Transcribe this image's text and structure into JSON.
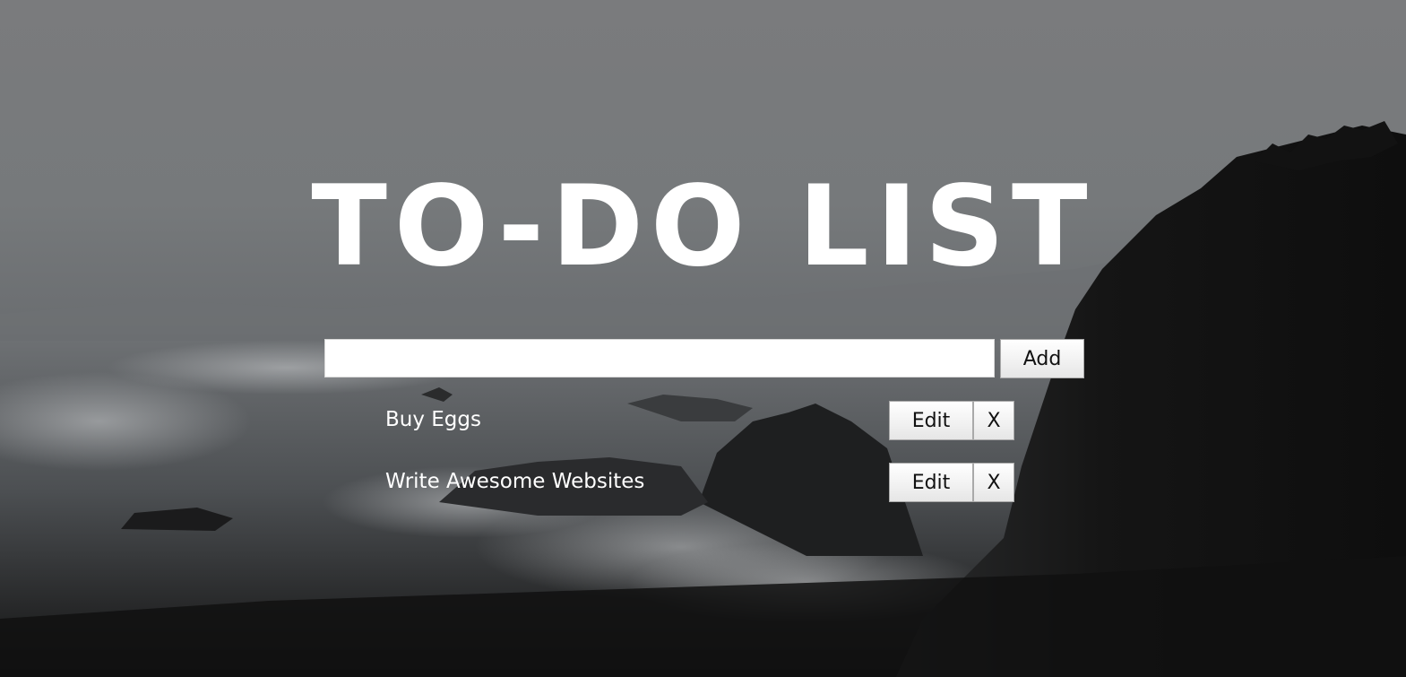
{
  "page": {
    "title": "TO-DO LIST"
  },
  "new_task": {
    "value": "",
    "add_label": "Add"
  },
  "tasks": [
    {
      "label": "Buy Eggs",
      "edit_label": "Edit",
      "delete_label": "X"
    },
    {
      "label": "Write Awesome Websites",
      "edit_label": "Edit",
      "delete_label": "X"
    }
  ],
  "colors": {
    "title": "#ffffff",
    "task_text": "#ffffff",
    "input_background": "#ffffff",
    "button_background": "#f0f0f0",
    "sky": "#7a7b7d",
    "rock": "#121212"
  }
}
